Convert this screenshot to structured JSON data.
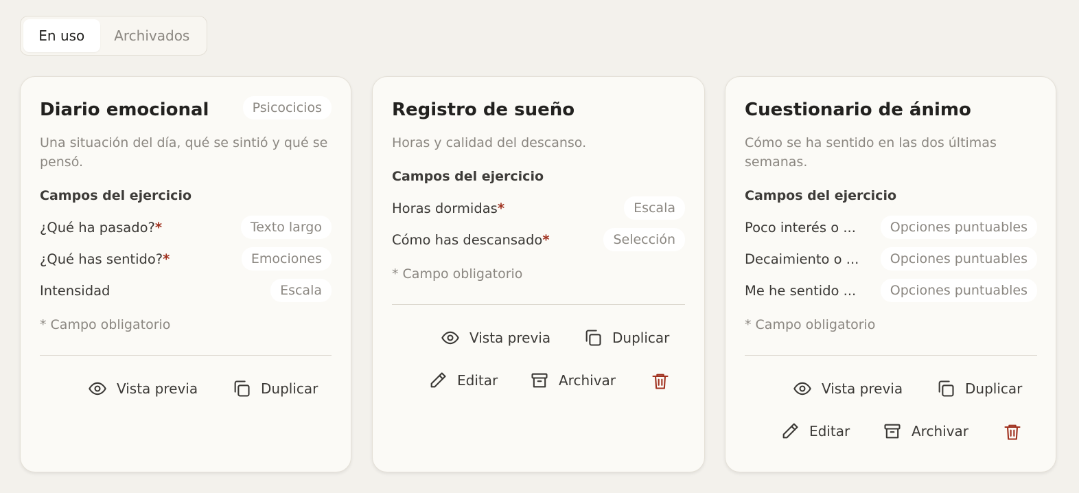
{
  "tabs": [
    {
      "label": "En uso",
      "active": true
    },
    {
      "label": "Archivados",
      "active": false
    }
  ],
  "colors": {
    "background": "#f3f1ec",
    "card": "#fbfaf6",
    "required": "#a0311f",
    "danger": "#a0311f"
  },
  "cards": [
    {
      "title": "Diario emocional",
      "badge": "Psicocicios",
      "description": "Una situación del día, qué se sintió y qué se pensó.",
      "fields_label": "Campos del ejercicio",
      "fields": [
        {
          "name": "¿Qué ha pasado?",
          "required": "*",
          "type": "Texto largo"
        },
        {
          "name": "¿Qué has sentido?",
          "required": "*",
          "type": "Emociones"
        },
        {
          "name": "Intensidad",
          "required": "",
          "type": "Escala"
        }
      ],
      "note": "* Campo obligatorio",
      "actions": {
        "preview": "Vista previa",
        "duplicate": "Duplicar"
      }
    },
    {
      "title": "Registro de sueño",
      "description": "Horas y calidad del descanso.",
      "fields_label": "Campos del ejercicio",
      "fields": [
        {
          "name": "Horas dormidas",
          "required": "*",
          "type": "Escala"
        },
        {
          "name": "Cómo has descansado",
          "required": "*",
          "type": "Selección"
        }
      ],
      "note": "* Campo obligatorio",
      "actions": {
        "preview": "Vista previa",
        "duplicate": "Duplicar",
        "edit": "Editar",
        "archive": "Archivar"
      }
    },
    {
      "title": "Cuestionario de ánimo",
      "description": "Cómo se ha sentido en las dos últimas semanas.",
      "fields_label": "Campos del ejercicio",
      "fields": [
        {
          "name": "Poco interés o ...",
          "required": "",
          "type": "Opciones puntuables"
        },
        {
          "name": "Decaimiento o ...",
          "required": "",
          "type": "Opciones puntuables"
        },
        {
          "name": "Me he sentido ...",
          "required": "",
          "type": "Opciones puntuables"
        }
      ],
      "note": "* Campo obligatorio",
      "actions": {
        "preview": "Vista previa",
        "duplicate": "Duplicar",
        "edit": "Editar",
        "archive": "Archivar"
      }
    }
  ],
  "icons": [
    "eye-icon",
    "copy-icon",
    "pencil-icon",
    "archive-icon",
    "trash-icon"
  ]
}
